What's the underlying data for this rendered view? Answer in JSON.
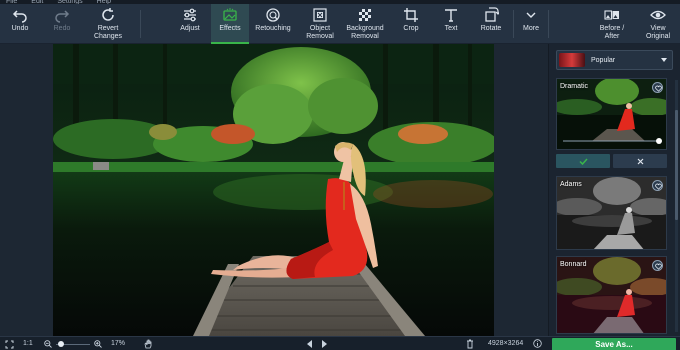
{
  "menubar": {
    "items": [
      "File",
      "Edit",
      "Settings",
      "Help"
    ]
  },
  "toolbar": {
    "undo": "Undo",
    "redo": "Redo",
    "revert": "Revert\nChanges",
    "adjust": "Adjust",
    "effects": "Effects",
    "retouching": "Retouching",
    "object_removal": "Object\nRemoval",
    "background_removal": "Background\nRemoval",
    "crop": "Crop",
    "text": "Text",
    "rotate": "Rotate",
    "more": "More",
    "before_after": "Before /\nAfter",
    "view_original": "View\nOriginal"
  },
  "panel": {
    "preset_select": "Popular",
    "filters": [
      {
        "label": "Dramatic"
      },
      {
        "label": "Adams"
      },
      {
        "label": "Bonnard"
      }
    ]
  },
  "statusbar": {
    "ratio": "1:1",
    "zoom": "17%",
    "image_size": "4928×3264",
    "save_button": "Save As..."
  },
  "colors": {
    "accent": "#39b54a",
    "save": "#2fa85a",
    "toolbar": "#253242",
    "panel": "#1b2430"
  }
}
